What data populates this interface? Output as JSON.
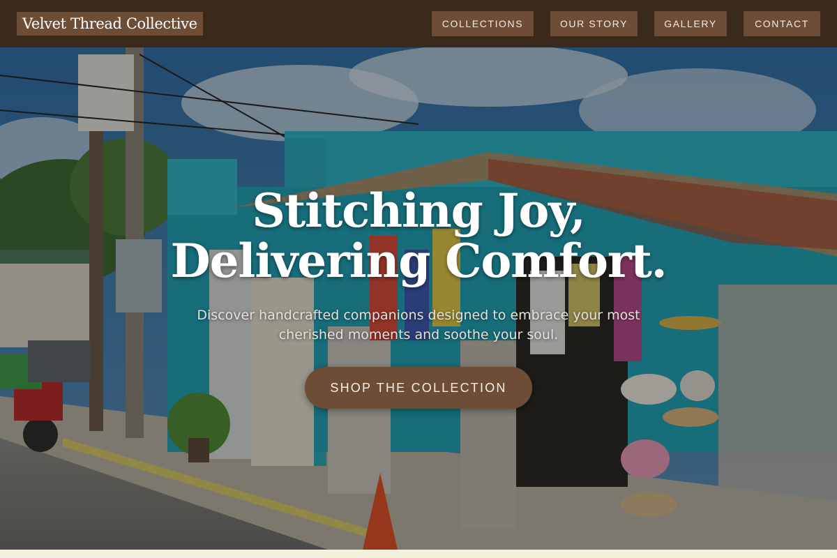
{
  "brand": {
    "name": "Velvet Thread Collective"
  },
  "nav": [
    {
      "label": "COLLECTIONS"
    },
    {
      "label": "OUR STORY"
    },
    {
      "label": "GALLERY"
    },
    {
      "label": "CONTACT"
    }
  ],
  "hero": {
    "title": "Stitching Joy, Delivering Comfort.",
    "subtitle": "Discover handcrafted companions designed to embrace your most cherished moments and soothe your soul.",
    "cta_label": "SHOP THE COLLECTION"
  },
  "colors": {
    "header_bg": "#3b291c",
    "button_bg": "#6e4d37",
    "page_bg": "#f3f1dc"
  }
}
